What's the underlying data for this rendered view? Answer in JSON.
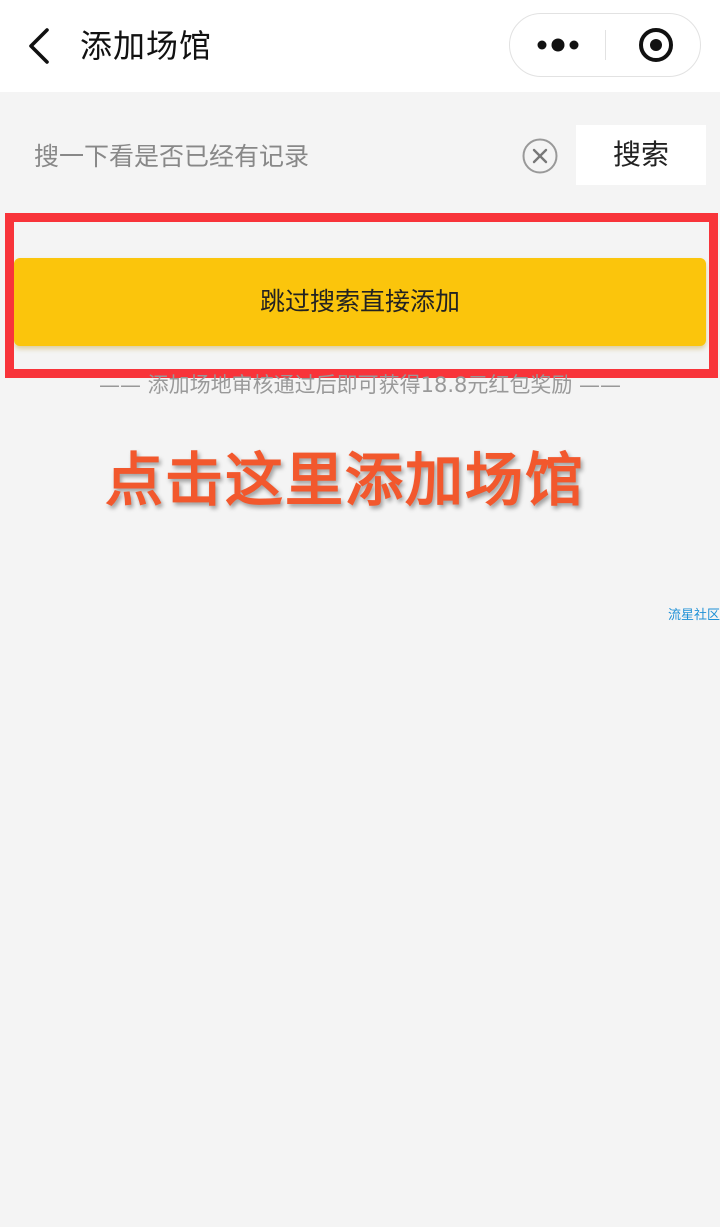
{
  "nav": {
    "title": "添加场馆",
    "back_icon": "chevron-left-icon",
    "more_icon": "more-dots-icon",
    "close_icon": "target-circle-icon"
  },
  "search": {
    "placeholder": "搜一下看是否已经有记录",
    "value": "",
    "clear_icon": "clear-circle-x-icon",
    "button_label": "搜索"
  },
  "skip": {
    "button_label": "跳过搜索直接添加"
  },
  "reward_note": "—— 添加场地审核通过后即可获得18.8元红包奖励 ——",
  "annotation": {
    "text": "点击这里添加场馆",
    "highlight_color": "#f8343a",
    "text_color": "#f2582d"
  },
  "watermark": "流星社区",
  "colors": {
    "accent": "#fbc50c",
    "background": "#f4f4f4",
    "nav_background": "#ffffff"
  }
}
